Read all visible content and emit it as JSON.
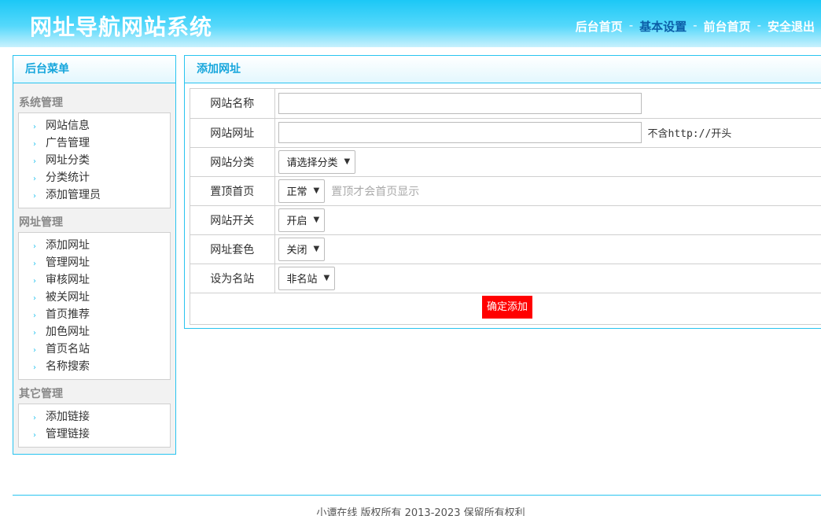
{
  "header": {
    "title": "网址导航网站系统",
    "nav": [
      {
        "label": "后台首页",
        "active": false
      },
      {
        "label": "基本设置",
        "active": true
      },
      {
        "label": "前台首页",
        "active": false
      },
      {
        "label": "安全退出",
        "active": false
      }
    ],
    "separator": "-"
  },
  "sidebar": {
    "title": "后台菜单",
    "groups": [
      {
        "title": "系统管理",
        "items": [
          "网站信息",
          "广告管理",
          "网址分类",
          "分类统计",
          "添加管理员"
        ]
      },
      {
        "title": "网址管理",
        "items": [
          "添加网址",
          "管理网址",
          "审核网址",
          "被关网址",
          "首页推荐",
          "加色网址",
          "首页名站",
          "名称搜索"
        ]
      },
      {
        "title": "其它管理",
        "items": [
          "添加链接",
          "管理链接"
        ]
      }
    ],
    "arrow_icon": "chevron-right-icon"
  },
  "main": {
    "title": "添加网址",
    "fields": {
      "name": {
        "label": "网站名称",
        "value": ""
      },
      "url": {
        "label": "网站网址",
        "value": "",
        "hint": "不含http://开头"
      },
      "category": {
        "label": "网站分类",
        "selected": "请选择分类"
      },
      "pin": {
        "label": "置顶首页",
        "selected": "正常",
        "hint": "置顶才会首页显示"
      },
      "switch": {
        "label": "网站开关",
        "selected": "开启"
      },
      "color": {
        "label": "网址套色",
        "selected": "关闭"
      },
      "famous": {
        "label": "设为名站",
        "selected": "非名站"
      }
    },
    "submit_label": "确定添加"
  },
  "footer": {
    "text": "小谭在线 版权所有 2013-2023 保留所有权利"
  },
  "colors": {
    "accent": "#29c4f0",
    "header_top": "#1cc8f6",
    "active_nav": "#0b5ea8",
    "submit": "#ff0000"
  }
}
